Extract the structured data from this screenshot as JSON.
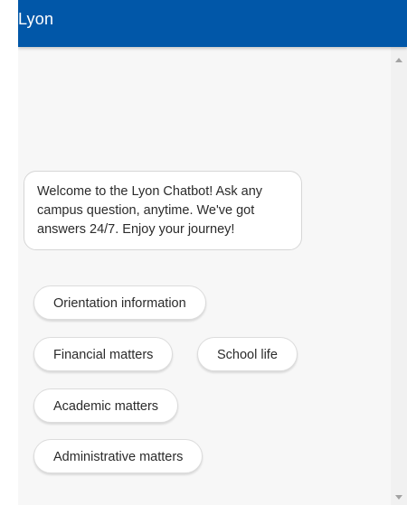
{
  "header": {
    "title": "Lyon"
  },
  "messages": [
    {
      "sender": "bot",
      "text": "Welcome to the Lyon Chatbot! Ask any campus question, anytime. We've got answers 24/7. Enjoy your journey!"
    }
  ],
  "quick_replies": [
    {
      "label": "Orientation information"
    },
    {
      "label": "Financial matters"
    },
    {
      "label": "School life"
    },
    {
      "label": "Academic matters"
    },
    {
      "label": "Administrative matters"
    }
  ],
  "colors": {
    "header_bg": "#0157a8",
    "chat_bg": "#f7f7f7",
    "bubble_bg": "#ffffff"
  },
  "icons": {
    "scroll_up": "triangle-up-icon",
    "scroll_down": "triangle-down-icon"
  }
}
